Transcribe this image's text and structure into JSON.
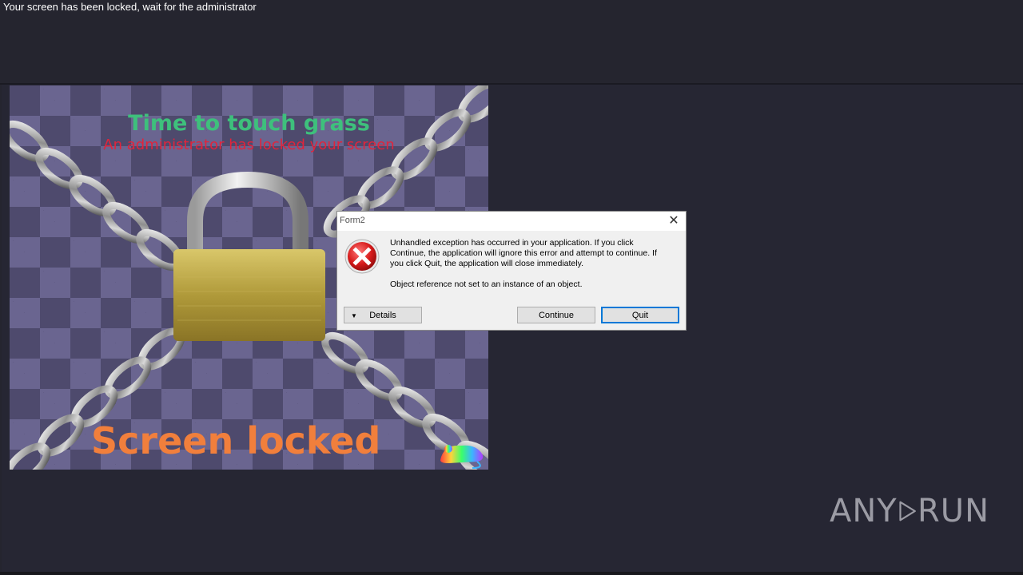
{
  "screen": {
    "lock_message": "Your screen has been locked, wait for the administrator"
  },
  "locker_image": {
    "headline_top": "Time to touch grass",
    "headline_sub": "An administrator has locked your screen",
    "headline_bottom": "Screen locked"
  },
  "dialog": {
    "title": "Form2",
    "message": "Unhandled exception has occurred in your application. If you click Continue, the application will ignore this error and attempt to continue. If you click Quit, the application will close immediately.",
    "detail": "Object reference not set to an instance of an object.",
    "details_label": "Details",
    "continue_label": "Continue",
    "quit_label": "Quit"
  },
  "watermark": {
    "left_text": "ANY",
    "right_text": "RUN"
  },
  "colors": {
    "background": "#25252f",
    "headline_green": "#3ec07c",
    "headline_red": "#e0243c",
    "headline_orange": "#f17f3c",
    "quit_focus": "#0078d7"
  }
}
